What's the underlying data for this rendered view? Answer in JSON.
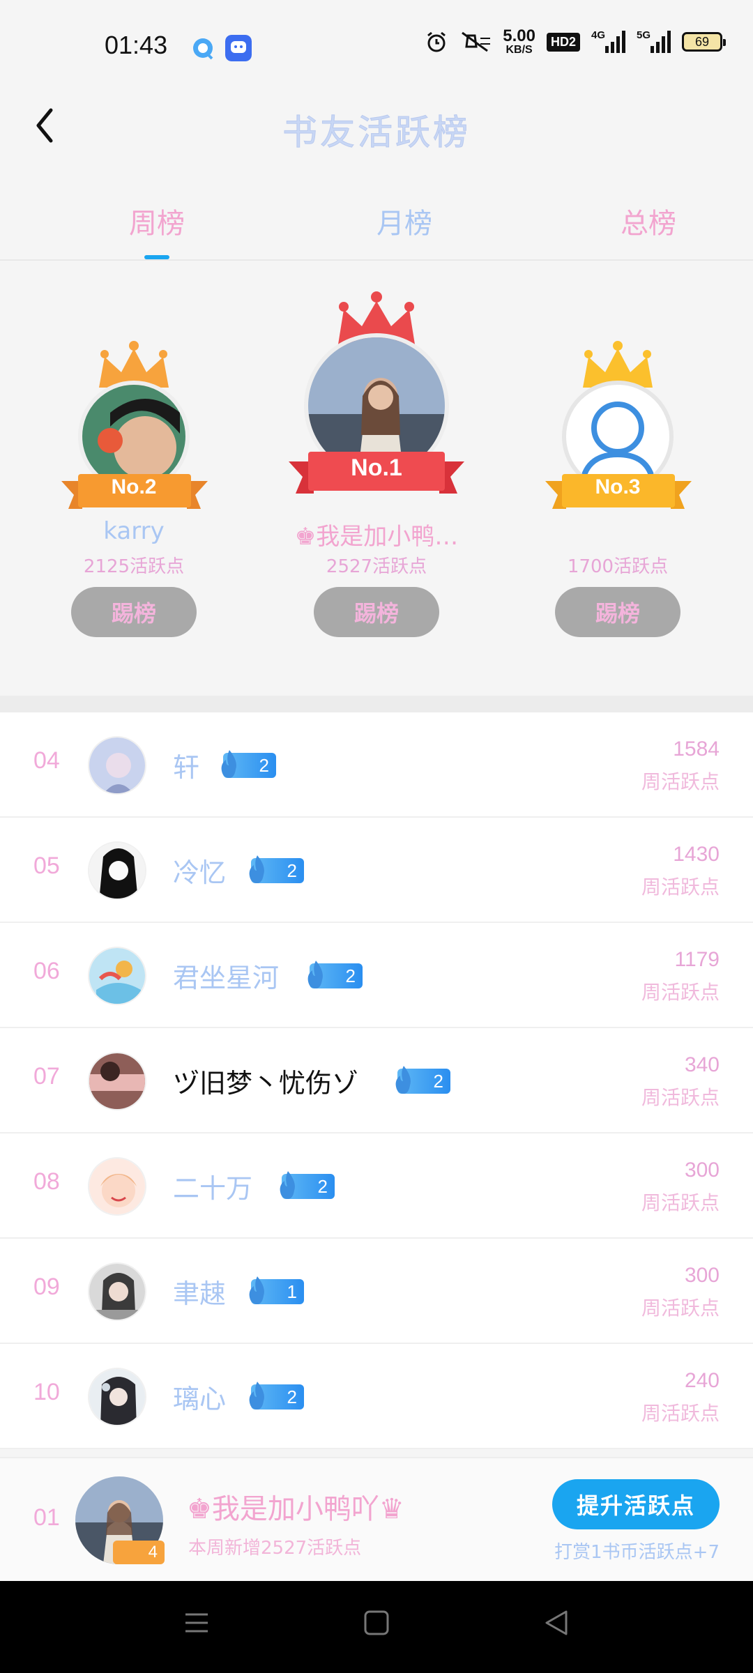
{
  "status_bar": {
    "time": "01:43",
    "net_speed_value": "5.00",
    "net_speed_unit": "KB/S",
    "hd_label": "HD2",
    "sig1_label": "4G",
    "sig2_label": "5G",
    "battery": "69"
  },
  "header": {
    "title": "书友活跃榜"
  },
  "tabs": [
    {
      "label": "周榜",
      "active": true
    },
    {
      "label": "月榜",
      "active": false
    },
    {
      "label": "总榜",
      "active": false
    }
  ],
  "podium": {
    "first": {
      "badge": "No.1",
      "name": "♚我是加小鸭…",
      "points": "2527活跃点",
      "button": "踢榜"
    },
    "second": {
      "badge": "No.2",
      "name": "karry",
      "points": "2125活跃点",
      "button": "踢榜"
    },
    "third": {
      "badge": "No.3",
      "name": "",
      "points": "1700活跃点",
      "button": "踢榜"
    }
  },
  "rankings": [
    {
      "rank": "04",
      "name": "轩",
      "level": "2",
      "points": "1584",
      "points_label": "周活跃点"
    },
    {
      "rank": "05",
      "name": "冷忆",
      "level": "2",
      "points": "1430",
      "points_label": "周活跃点"
    },
    {
      "rank": "06",
      "name": "君坐星河",
      "level": "2",
      "points": "1179",
      "points_label": "周活跃点"
    },
    {
      "rank": "07",
      "name": "ヅ旧梦丶忧伤ゾ",
      "level": "2",
      "points": "340",
      "points_label": "周活跃点"
    },
    {
      "rank": "08",
      "name": "二十万",
      "level": "2",
      "points": "300",
      "points_label": "周活跃点"
    },
    {
      "rank": "09",
      "name": "聿趚",
      "level": "1",
      "points": "300",
      "points_label": "周活跃点"
    },
    {
      "rank": "10",
      "name": "璃心",
      "level": "2",
      "points": "240",
      "points_label": "周活跃点"
    }
  ],
  "my_rank": {
    "rank": "01",
    "level": "4",
    "name": "♚我是加小鸭吖♛",
    "subtitle": "本周新增2527活跃点",
    "button": "提升活跃点",
    "note": "打赏1书币活跃点+7"
  },
  "colors": {
    "accent": "#1aa5f0",
    "pink": "#f2a4cf",
    "blue": "#a9c6f3"
  }
}
